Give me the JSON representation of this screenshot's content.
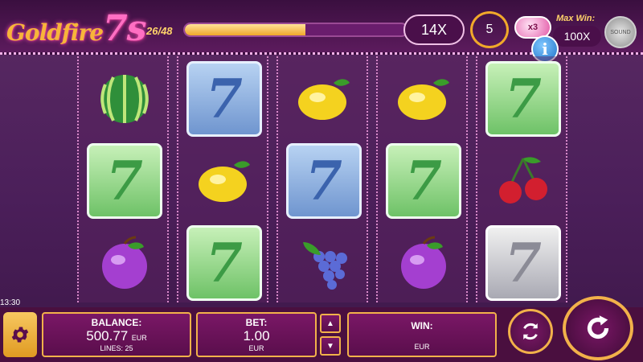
{
  "header": {
    "logo_text": "Goldfire",
    "logo_seven": "7s",
    "progress_text": "26/48",
    "progress_fraction": 0.5417,
    "multiplier": "14X",
    "spins_remaining": "5",
    "bonus_badge": "x3",
    "max_win_label": "Max Win:",
    "max_win_value": "100X",
    "sound_label": "SOUND",
    "info_label": "i"
  },
  "reels": [
    [
      "watermelon",
      "green-seven",
      "plum"
    ],
    [
      "blue-seven",
      "lemon",
      "green-seven"
    ],
    [
      "lemon",
      "blue-seven",
      "grapes"
    ],
    [
      "lemon",
      "green-seven",
      "plum"
    ],
    [
      "green-seven",
      "cherries",
      "silver-seven"
    ]
  ],
  "seven_glyph": "7",
  "footer": {
    "clock": "13:30",
    "balance_label": "BALANCE:",
    "balance_value": "500.77",
    "balance_currency": "EUR",
    "lines_text": "LINES: 25",
    "bet_label": "BET:",
    "bet_value": "1.00",
    "bet_currency": "EUR",
    "bet_up_icon": "▲",
    "bet_down_icon": "▼",
    "win_label": "WIN:",
    "win_currency": "EUR"
  },
  "colors": {
    "accent_gold": "#f2b14a",
    "panel_purple": "#7a1766",
    "background": "#4b1f5a"
  }
}
